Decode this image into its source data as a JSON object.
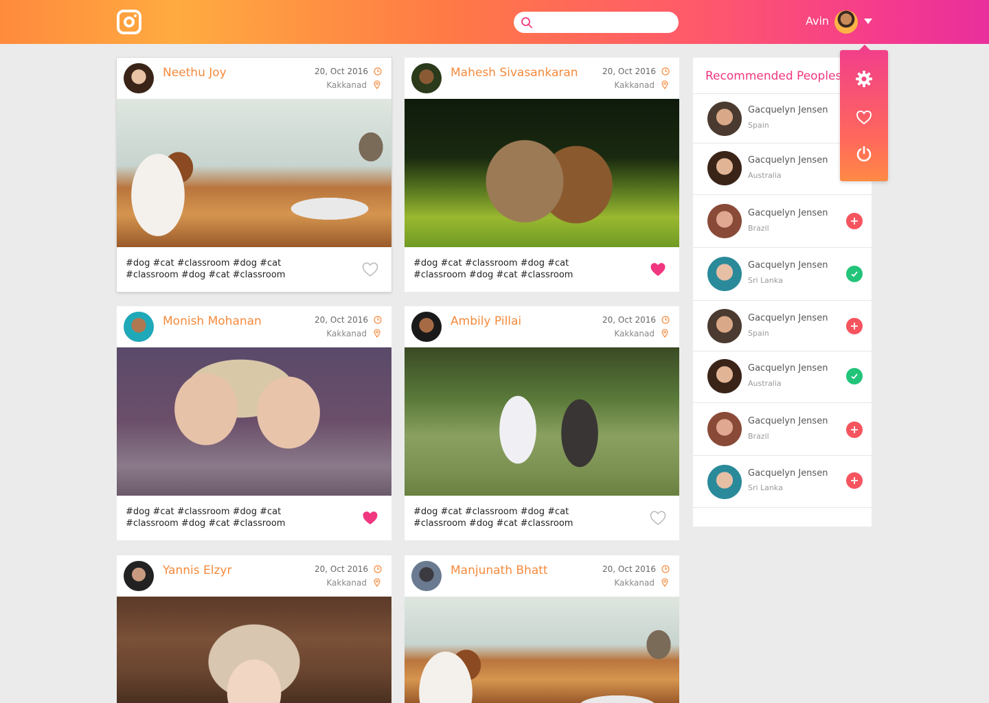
{
  "header": {
    "search_placeholder": "",
    "user_name": "Avin"
  },
  "menu": {
    "items": [
      {
        "name": "gear-icon"
      },
      {
        "name": "heart-outline-icon"
      },
      {
        "name": "power-icon"
      }
    ]
  },
  "posts": [
    {
      "author": "Neethu Joy",
      "date": "20, Oct 2016",
      "location": "Kakkanad",
      "tags": "#dog #cat #classroom #dog #cat #classroom #dog #cat #classroom",
      "liked": false
    },
    {
      "author": "Mahesh Sivasankaran",
      "date": "20, Oct 2016",
      "location": "Kakkanad",
      "tags": "#dog #cat #classroom #dog #cat #classroom #dog #cat #classroom",
      "liked": true
    },
    {
      "author": "Monish Mohanan",
      "date": "20, Oct 2016",
      "location": "Kakkanad",
      "tags": "#dog #cat #classroom #dog #cat #classroom #dog #cat #classroom",
      "liked": true
    },
    {
      "author": "Ambily Pillai",
      "date": "20, Oct 2016",
      "location": "Kakkanad",
      "tags": "#dog #cat #classroom #dog #cat #classroom #dog #cat #classroom",
      "liked": false
    },
    {
      "author": "Yannis Elzyr",
      "date": "20, Oct 2016",
      "location": "Kakkanad"
    },
    {
      "author": "Manjunath Bhatt",
      "date": "20, Oct 2016",
      "location": "Kakkanad"
    }
  ],
  "recommended": {
    "title": "Recommended Peoples",
    "people": [
      {
        "name": "Gacquelyn Jensen",
        "location": "Spain",
        "status": "none"
      },
      {
        "name": "Gacquelyn Jensen",
        "location": "Australia",
        "status": "none"
      },
      {
        "name": "Gacquelyn Jensen",
        "location": "Brazil",
        "status": "add"
      },
      {
        "name": "Gacquelyn Jensen",
        "location": "Sri Lanka",
        "status": "added"
      },
      {
        "name": "Gacquelyn Jensen",
        "location": "Spain",
        "status": "add"
      },
      {
        "name": "Gacquelyn Jensen",
        "location": "Australia",
        "status": "added"
      },
      {
        "name": "Gacquelyn Jensen",
        "location": "Brazil",
        "status": "add"
      },
      {
        "name": "Gacquelyn Jensen",
        "location": "Sri Lanka",
        "status": "add"
      }
    ]
  },
  "colors": {
    "accent_orange": "#f58a3c",
    "accent_pink": "#f0367f",
    "like": "#f0367f",
    "add": "#f6545f",
    "added": "#22c47a"
  }
}
